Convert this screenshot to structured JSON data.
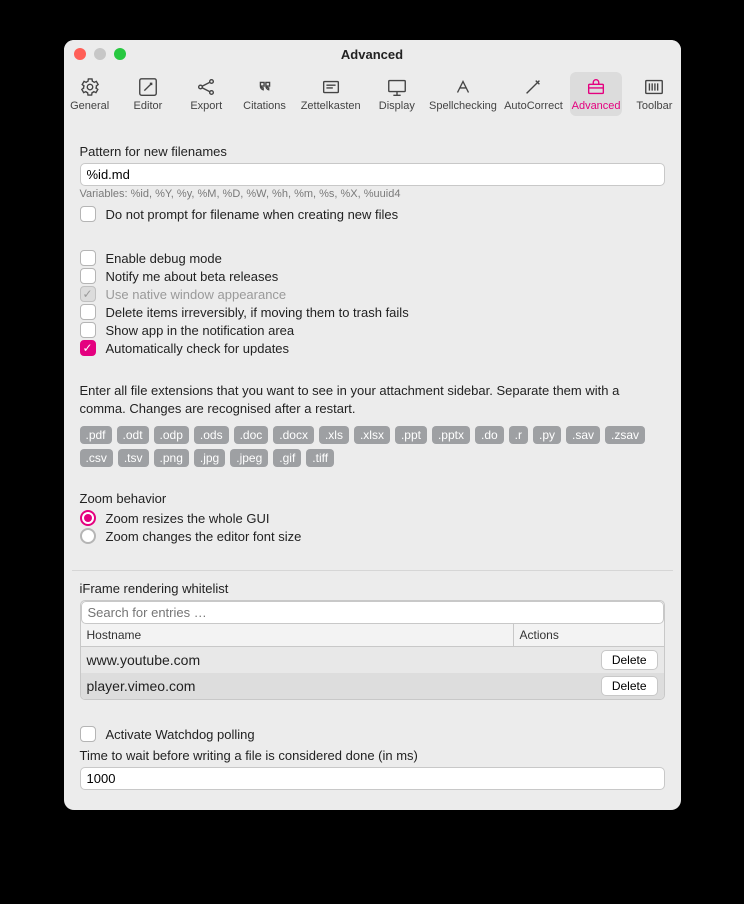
{
  "window": {
    "title": "Advanced"
  },
  "toolbar": {
    "tabs": [
      {
        "id": "general",
        "label": "General"
      },
      {
        "id": "editor",
        "label": "Editor"
      },
      {
        "id": "export",
        "label": "Export"
      },
      {
        "id": "citations",
        "label": "Citations"
      },
      {
        "id": "zettelkasten",
        "label": "Zettelkasten"
      },
      {
        "id": "display",
        "label": "Display"
      },
      {
        "id": "spellchecking",
        "label": "Spellchecking"
      },
      {
        "id": "autocorrect",
        "label": "AutoCorrect"
      },
      {
        "id": "advanced",
        "label": "Advanced"
      },
      {
        "id": "toolbar",
        "label": "Toolbar"
      }
    ]
  },
  "filename": {
    "label": "Pattern for new filenames",
    "value": "%id.md",
    "hint": "Variables: %id, %Y, %y, %M, %D, %W, %h, %m, %s, %X, %uuid4",
    "no_prompt_label": "Do not prompt for filename when creating new files"
  },
  "flags": {
    "debug": "Enable debug mode",
    "beta": "Notify me about beta releases",
    "native_window": "Use native window appearance",
    "delete_irreversibly": "Delete items irreversibly, if moving them to trash fails",
    "notification_area": "Show app in the notification area",
    "auto_update": "Automatically check for updates"
  },
  "extensions": {
    "text": "Enter all file extensions that you want to see in your attachment sidebar. Separate them with a comma. Changes are recognised after a restart.",
    "items": [
      ".pdf",
      ".odt",
      ".odp",
      ".ods",
      ".doc",
      ".docx",
      ".xls",
      ".xlsx",
      ".ppt",
      ".pptx",
      ".do",
      ".r",
      ".py",
      ".sav",
      ".zsav",
      ".csv",
      ".tsv",
      ".png",
      ".jpg",
      ".jpeg",
      ".gif",
      ".tiff"
    ]
  },
  "zoom": {
    "heading": "Zoom behavior",
    "opt_gui": "Zoom resizes the whole GUI",
    "opt_editor": "Zoom changes the editor font size"
  },
  "iframe": {
    "heading": "iFrame rendering whitelist",
    "search_placeholder": "Search for entries …",
    "col_host": "Hostname",
    "col_actions": "Actions",
    "delete_label": "Delete",
    "rows": [
      {
        "host": "www.youtube.com"
      },
      {
        "host": "player.vimeo.com"
      }
    ]
  },
  "watchdog": {
    "activate_label": "Activate Watchdog polling",
    "wait_label": "Time to wait before writing a file is considered done (in ms)",
    "wait_value": "1000"
  }
}
